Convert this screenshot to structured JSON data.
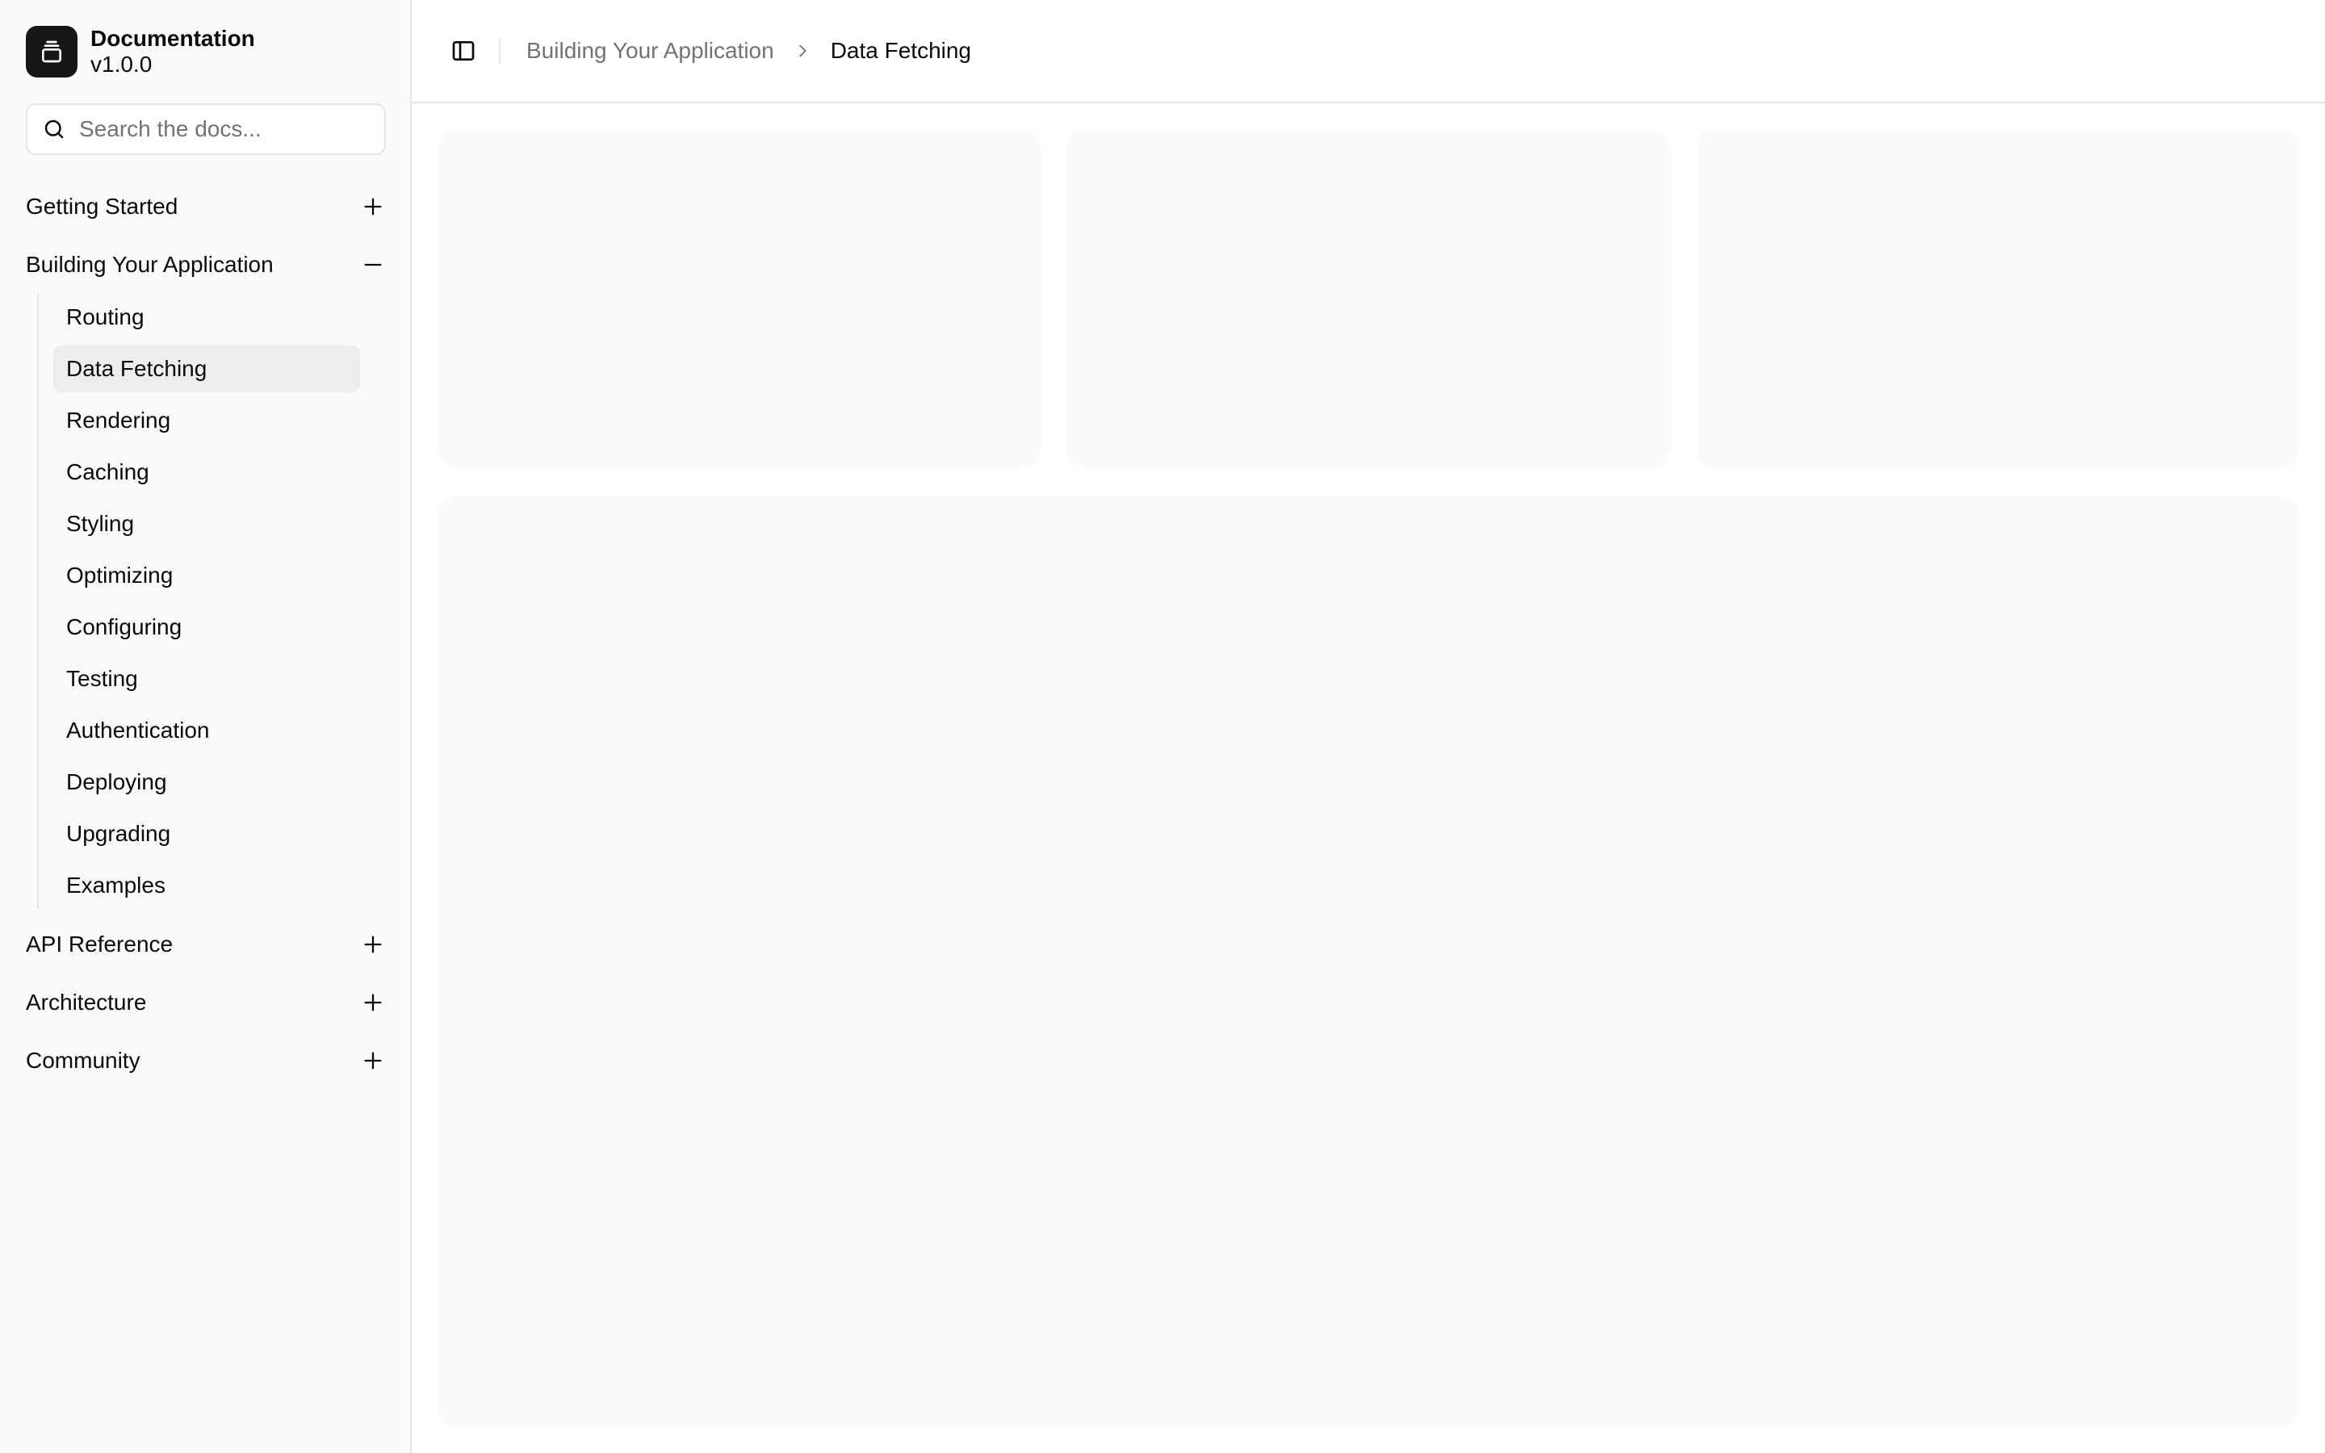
{
  "brand": {
    "title": "Documentation",
    "version": "v1.0.0",
    "logo_icon": "gallery-stack-icon",
    "logo_color": "#171717"
  },
  "search": {
    "placeholder": "Search the docs..."
  },
  "sidebar": {
    "groups": [
      {
        "label": "Getting Started",
        "expanded": false
      },
      {
        "label": "Building Your Application",
        "expanded": true,
        "items": [
          {
            "label": "Routing"
          },
          {
            "label": "Data Fetching",
            "active": true
          },
          {
            "label": "Rendering"
          },
          {
            "label": "Caching"
          },
          {
            "label": "Styling"
          },
          {
            "label": "Optimizing"
          },
          {
            "label": "Configuring"
          },
          {
            "label": "Testing"
          },
          {
            "label": "Authentication"
          },
          {
            "label": "Deploying"
          },
          {
            "label": "Upgrading"
          },
          {
            "label": "Examples"
          }
        ]
      },
      {
        "label": "API Reference",
        "expanded": false
      },
      {
        "label": "Architecture",
        "expanded": false
      },
      {
        "label": "Community",
        "expanded": false
      }
    ]
  },
  "breadcrumb": {
    "parent": "Building Your Application",
    "current": "Data Fetching"
  },
  "colors": {
    "sidebar_bg": "#fafafa",
    "border": "#e5e5e5",
    "active_item_bg": "#ededed",
    "muted_text": "#737373",
    "placeholder_card_bg": "#fafafa"
  }
}
